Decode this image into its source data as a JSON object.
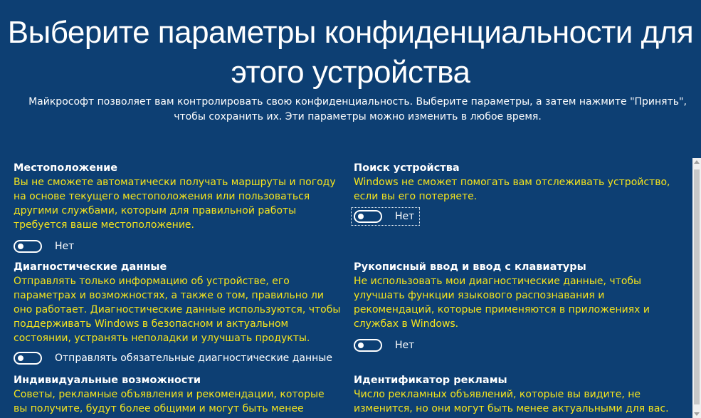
{
  "header": {
    "title": "Выберите параметры конфиденциальности для этого устройства",
    "subtitle": "Майкрософт позволяет вам контролировать свою конфиденциальность. Выберите параметры, а затем нажмите \"Принять\", чтобы сохранить их. Эти параметры можно изменить в любое время."
  },
  "sections": {
    "location": {
      "title": "Местоположение",
      "description": "Вы не сможете автоматически получать маршруты и погоду на основе текущего местоположения или пользоваться другими службами, которым для правильной работы требуется ваше местоположение.",
      "toggle_label": "Нет",
      "toggle_on": false
    },
    "find_device": {
      "title": "Поиск устройства",
      "description": "Windows не сможет помогать вам отслеживать устройство, если вы его потеряете.",
      "toggle_label": "Нет",
      "toggle_on": false
    },
    "diagnostics": {
      "title": "Диагностические данные",
      "description": "Отправлять только информацию об устройстве, его параметрах и возможностях, а также о том, правильно ли оно работает. Диагностические данные используются, чтобы поддерживать Windows в безопасном и актуальном состоянии, устранять неполадки и улучшать продукты.",
      "toggle_label": "Отправлять обязательные диагностические данные",
      "toggle_on": false
    },
    "inking": {
      "title": "Рукописный ввод и ввод с клавиатуры",
      "description": "Не использовать мои диагностические данные, чтобы улучшать функции языкового распознавания и рекомендаций, которые применяются в приложениях и службах в Windows.",
      "toggle_label": "Нет",
      "toggle_on": false
    },
    "tailored": {
      "title": "Индивидуальные возможности",
      "description": "Советы, рекламные объявления и рекомендации, которые вы получите, будут более общими и могут быть менее актуальными"
    },
    "ad_id": {
      "title": "Идентификатор рекламы",
      "description": "Число рекламных объявлений, которые вы видите, не изменится, но они могут быть менее актуальными для вас."
    }
  },
  "colors": {
    "background": "#0d3f73",
    "description_text": "#f5e41d",
    "title_text": "#ffffff"
  }
}
